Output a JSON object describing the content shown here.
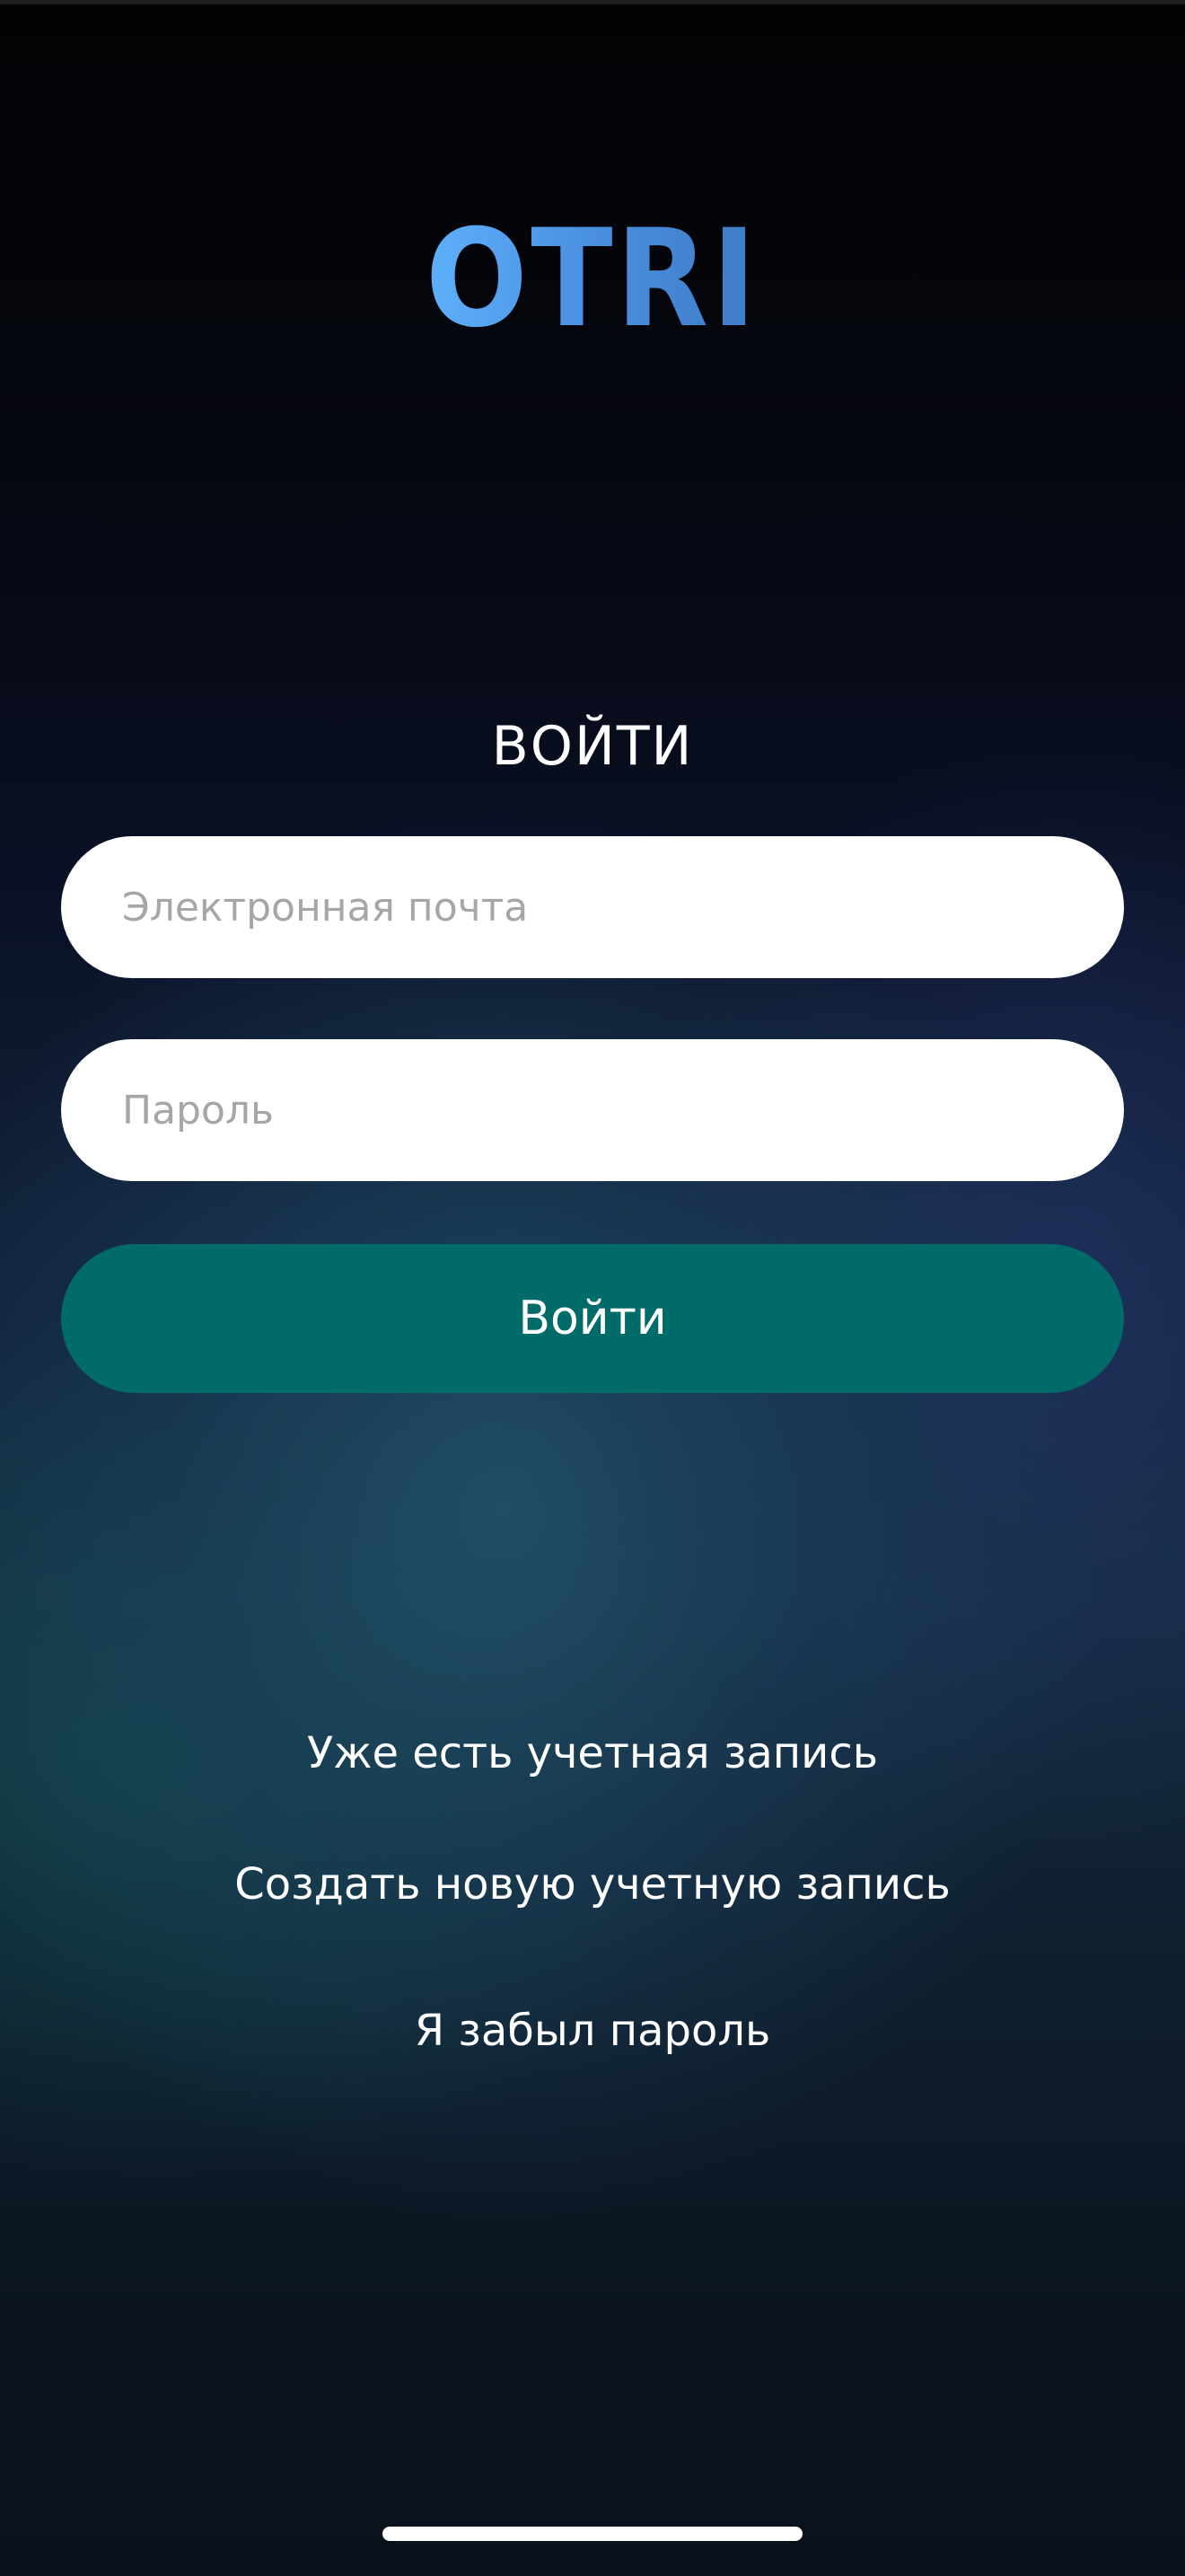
{
  "app": {
    "logo_text": "OTRI",
    "logo_colors": [
      "#5aa9f7",
      "#4a8ee0",
      "#3f7dc8"
    ]
  },
  "login": {
    "title": "ВОЙТИ",
    "email_placeholder": "Электронная почта",
    "password_placeholder": "Пароль",
    "submit_label": "Войти",
    "accent_color": "#016b6a"
  },
  "links": {
    "have_account": "Уже есть учетная запись",
    "create_account": "Создать новую учетную запись",
    "forgot_password": "Я забыл пароль"
  }
}
